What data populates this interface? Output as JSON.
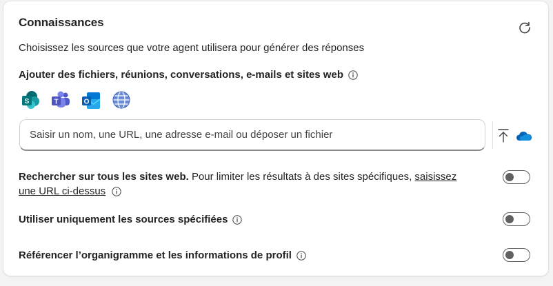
{
  "knowledge": {
    "title": "Connaissances",
    "subtitle": "Choisissez les sources que votre agent utilisera pour générer des réponses",
    "add_section_title": "Ajouter des fichiers, réunions, conversations, e-mails et sites web",
    "sources": [
      "sharepoint-icon",
      "teams-icon",
      "outlook-icon",
      "web-globe-icon"
    ],
    "input_placeholder": "Saisir un nom, une URL, une adresse e-mail ou déposer un fichier"
  },
  "options": {
    "search_web_bold": "Rechercher sur tous les sites web.",
    "search_web_text": " Pour limiter les résultats à des sites spécifiques, ",
    "search_web_link": "saisissez une URL ci-dessus",
    "only_sources_label": "Utiliser uniquement les sources spécifiées",
    "org_chart_label": "Référencer l’organigramme et les informations de profil",
    "toggles": {
      "search_web": false,
      "only_sources": false,
      "org_chart": false
    }
  },
  "colors": {
    "text": "#242424",
    "toggle_off": "#616161",
    "onedrive": "#0364b8",
    "sharepoint": "#038387",
    "teams": "#5b5fc7",
    "outlook": "#0a5fb4"
  }
}
